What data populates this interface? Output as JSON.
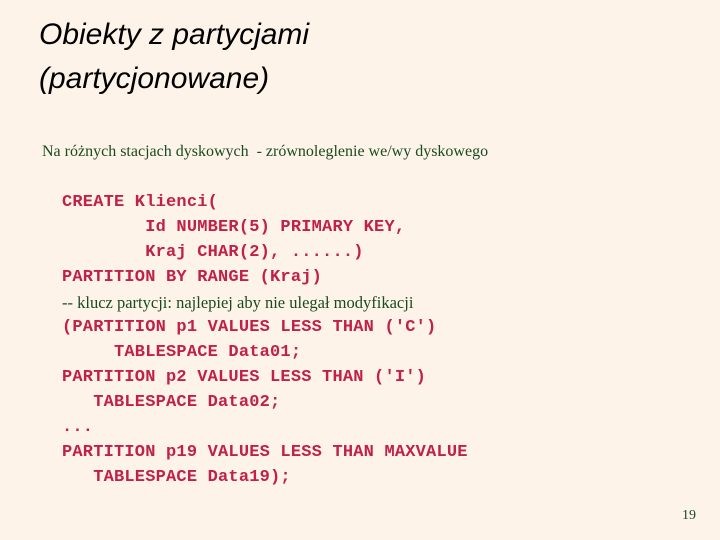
{
  "slide": {
    "background_color": "#fdf3e9",
    "title": {
      "line1": "Obiekty z partycjami",
      "line2": "(partycjonowane)",
      "color": "#000000"
    },
    "subtitle": {
      "text": "Na różnych stacjach dyskowych  - zrównoleglenie we/wy dyskowego",
      "color": "#1a4a20"
    },
    "code": {
      "color": "#c0204a",
      "comment_color": "#1a4a20",
      "lines": [
        {
          "text": "CREATE Klienci(",
          "kind": "code"
        },
        {
          "text": "        Id NUMBER(5) PRIMARY KEY,",
          "kind": "code"
        },
        {
          "text": "        Kraj CHAR(2), ......)",
          "kind": "code"
        },
        {
          "text": "PARTITION BY RANGE (Kraj)",
          "kind": "code"
        },
        {
          "text": "-- klucz partycji: najlepiej aby nie ulegał modyfikacji",
          "kind": "comment"
        },
        {
          "text": "(PARTITION p1 VALUES LESS THAN ('C')",
          "kind": "code"
        },
        {
          "text": "     TABLESPACE Data01;",
          "kind": "code"
        },
        {
          "text": "PARTITION p2 VALUES LESS THAN ('I')",
          "kind": "code"
        },
        {
          "text": "   TABLESPACE Data02;",
          "kind": "code"
        },
        {
          "text": "...",
          "kind": "code"
        },
        {
          "text": "PARTITION p19 VALUES LESS THAN MAXVALUE",
          "kind": "code"
        },
        {
          "text": "   TABLESPACE Data19);",
          "kind": "code"
        }
      ]
    },
    "page_number": "19"
  }
}
